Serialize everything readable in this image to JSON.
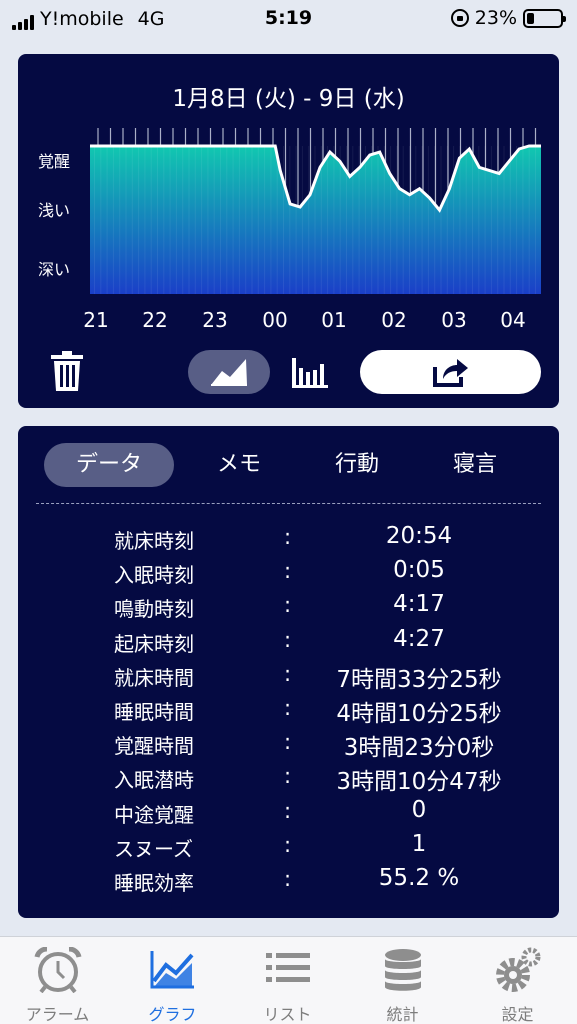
{
  "status_bar": {
    "carrier": "Y!mobile",
    "network": "4G",
    "time": "5:19",
    "battery_percent": "23%",
    "battery_level": 0.23
  },
  "graph": {
    "title": "1月8日 (火) - 9日 (水)",
    "chart_data": {
      "type": "area",
      "title": "1月8日 (火) - 9日 (水)",
      "y_levels": [
        "覚醒",
        "浅い",
        "深い"
      ],
      "y_values": [
        2,
        1,
        0
      ],
      "x_ticks": [
        "21",
        "22",
        "23",
        "00",
        "01",
        "02",
        "03",
        "04"
      ],
      "x": [
        "20:54",
        "21:00",
        "22:00",
        "23:00",
        "00:00",
        "00:05",
        "00:15",
        "00:25",
        "00:35",
        "00:45",
        "00:55",
        "01:05",
        "01:15",
        "01:25",
        "01:35",
        "01:45",
        "01:55",
        "02:05",
        "02:15",
        "02:25",
        "02:35",
        "02:45",
        "02:55",
        "03:05",
        "03:15",
        "03:25",
        "03:35",
        "03:45",
        "03:55",
        "04:05",
        "04:15",
        "04:27"
      ],
      "values": [
        2,
        2,
        2,
        2,
        2,
        1.6,
        1.05,
        1.0,
        1.2,
        1.65,
        1.9,
        1.75,
        1.5,
        1.65,
        1.85,
        1.9,
        1.55,
        1.3,
        1.2,
        1.3,
        1.15,
        0.95,
        1.3,
        1.8,
        1.95,
        1.65,
        1.6,
        1.55,
        1.75,
        1.95,
        2,
        2
      ],
      "tick_marks": "motion events shown as vertical lines above curve",
      "colors": {
        "top": "#11c8b0",
        "bottom": "#1a3fc8",
        "line": "#ffffff"
      }
    }
  },
  "controls": {
    "trash_icon": "trash-icon",
    "line_mode_icon": "line-chart-icon",
    "bar_mode_icon": "bar-chart-icon",
    "share_icon": "share-icon"
  },
  "tabs": [
    {
      "label": "データ",
      "active": true
    },
    {
      "label": "メモ",
      "active": false
    },
    {
      "label": "行動",
      "active": false
    },
    {
      "label": "寝言",
      "active": false
    }
  ],
  "rows": [
    {
      "label": "就床時刻",
      "colon": ":",
      "value": "20:54"
    },
    {
      "label": "入眠時刻",
      "colon": ":",
      "value": "0:05"
    },
    {
      "label": "鳴動時刻",
      "colon": ":",
      "value": "4:17"
    },
    {
      "label": "起床時刻",
      "colon": ":",
      "value": "4:27"
    },
    {
      "label": "就床時間",
      "colon": ":",
      "value": "7時間33分25秒"
    },
    {
      "label": "睡眠時間",
      "colon": ":",
      "value": "4時間10分25秒"
    },
    {
      "label": "覚醒時間",
      "colon": ":",
      "value": "3時間23分0秒"
    },
    {
      "label": "入眠潜時",
      "colon": ":",
      "value": "3時間10分47秒"
    },
    {
      "label": "中途覚醒",
      "colon": ":",
      "value": "0"
    },
    {
      "label": "スヌーズ",
      "colon": ":",
      "value": "1"
    },
    {
      "label": "睡眠効率",
      "colon": ":",
      "value": "55.2 %"
    }
  ],
  "tab_bar": [
    {
      "label": "アラーム",
      "icon": "alarm-clock-icon",
      "active": false
    },
    {
      "label": "グラフ",
      "icon": "graph-icon",
      "active": true
    },
    {
      "label": "リスト",
      "icon": "list-icon",
      "active": false
    },
    {
      "label": "統計",
      "icon": "database-icon",
      "active": false
    },
    {
      "label": "設定",
      "icon": "gear-icon",
      "active": false
    }
  ],
  "accent_color": "#1f6fe0"
}
